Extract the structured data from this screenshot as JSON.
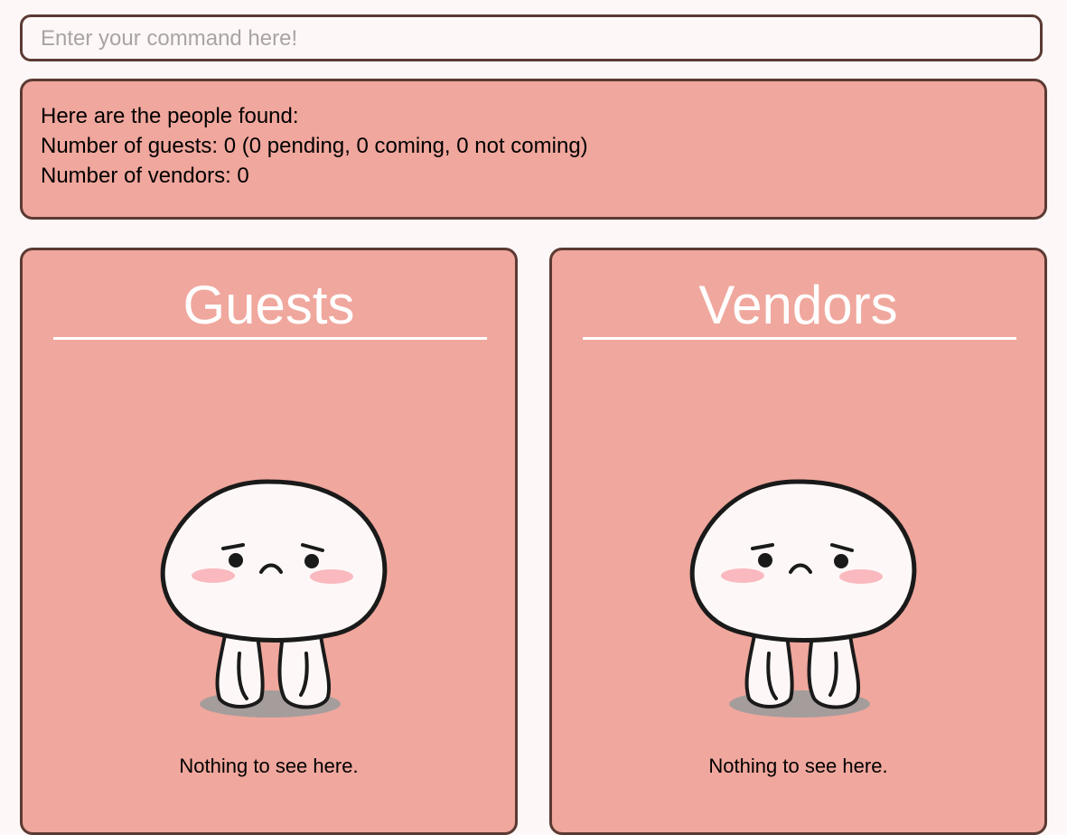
{
  "command": {
    "placeholder": "Enter your command here!",
    "value": ""
  },
  "result": {
    "lines": [
      "Here are the people found:",
      "Number of guests: 0 (0 pending, 0 coming, 0 not coming)",
      "Number of vendors: 0"
    ]
  },
  "guests_panel": {
    "title": "Guests",
    "empty_message": "Nothing to see here.",
    "illustration": "sad-blob-mascot"
  },
  "vendors_panel": {
    "title": "Vendors",
    "empty_message": "Nothing to see here.",
    "illustration": "sad-blob-mascot"
  },
  "colors": {
    "page_background": "#fdf8f7",
    "panel_background": "#f0a79d",
    "border": "#5b3a33",
    "title_text": "#ffffff",
    "placeholder_text": "#a9a4a3",
    "blush": "#f9b9bf"
  }
}
